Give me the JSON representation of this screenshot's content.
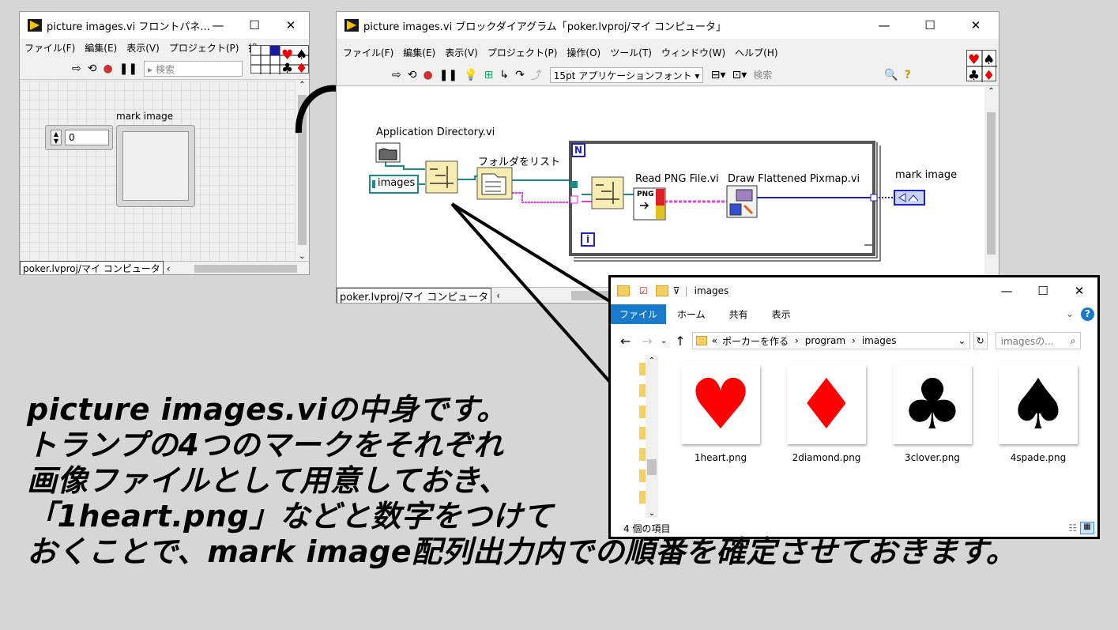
{
  "front_panel": {
    "title": "picture images.vi フロントパネ...",
    "menu": [
      "ファイル(F)",
      "編集(E)",
      "表示(V)",
      "プロジェクト(P)",
      "操"
    ],
    "search_placeholder": "検索",
    "numeric_value": "0",
    "indicator_label": "mark image",
    "status_path": "poker.lvproj/マイ コンピュータ"
  },
  "block_diagram": {
    "title": "picture images.vi ブロックダイアグラム「poker.lvproj/マイ コンピュータ」",
    "menu": [
      "ファイル(F)",
      "編集(E)",
      "表示(V)",
      "プロジェクト(P)",
      "操作(O)",
      "ツール(T)",
      "ウィンドウ(W)",
      "ヘルプ(H)"
    ],
    "font_select": "15pt アプリケーションフォント",
    "search_placeholder": "検索",
    "nodes": {
      "app_dir": "Application Directory.vi",
      "images_const": "images",
      "list_folder": "フォルダをリスト",
      "read_png": "Read PNG File.vi",
      "draw_pixmap": "Draw Flattened Pixmap.vi",
      "mark_image": "mark image",
      "loop_n": "N",
      "loop_i": "i",
      "png_text": "PNG"
    },
    "status_path": "poker.lvproj/マイ コンピュータ"
  },
  "explorer": {
    "title": "images",
    "ribbon_tabs": [
      "ファイル",
      "ホーム",
      "共有",
      "表示"
    ],
    "breadcrumb": [
      "«",
      "ポーカーを作る",
      "program",
      "images"
    ],
    "search_placeholder": "imagesの...",
    "files": [
      {
        "name": "1heart.png",
        "symbol": "♥",
        "color": "#ff0000"
      },
      {
        "name": "2diamond.png",
        "symbol": "♦",
        "color": "#ff0000"
      },
      {
        "name": "3clover.png",
        "symbol": "♣",
        "color": "#000000"
      },
      {
        "name": "4spade.png",
        "symbol": "♠",
        "color": "#000000"
      }
    ],
    "status": "4 個の項目"
  },
  "caption": {
    "lines": [
      "picture images.viの中身です。",
      "トランプの4つのマークをそれぞれ",
      "画像ファイルとして用意しておき、",
      "「1heart.png」などと数字をつけて",
      "おくことで、mark image配列出力内での順番を確定させておきます。"
    ]
  }
}
